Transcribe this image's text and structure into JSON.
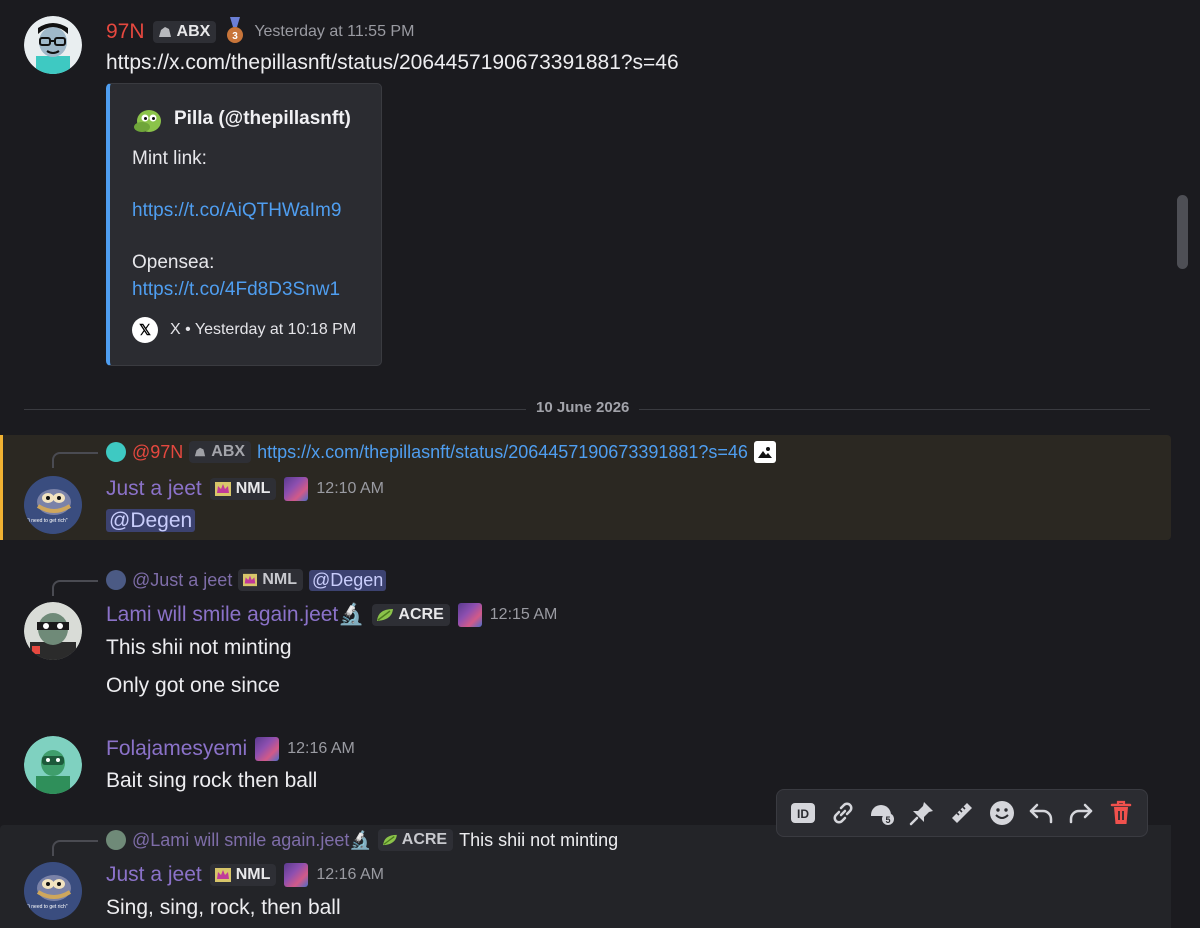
{
  "msg1": {
    "username": "97N",
    "tag": "ABX",
    "medal": "3",
    "timestamp": "Yesterday at 11:55 PM",
    "link": "https://x.com/thepillasnft/status/2064457190673391881?s=46",
    "embed": {
      "author": "Pilla (@thepillasnft)",
      "line1": "Mint link:",
      "link1": "https://t.co/AiQTHWaIm9",
      "line2": "Opensea:",
      "link2": "https://t.co/4Fd8D3Snw1",
      "footer": "X • Yesterday at 10:18 PM",
      "x_glyph": "𝕏"
    }
  },
  "divider": {
    "date": "10 June 2026"
  },
  "msg2": {
    "reply_user": "@97N",
    "reply_tag": "ABX",
    "reply_text": "https://x.com/thepillasnft/status/2064457190673391881?s=46",
    "username": "Just a jeet",
    "tag": "NML",
    "timestamp": "12:10 AM",
    "mention": "@Degen",
    "avatar_caption": "\"i need to get rich\""
  },
  "msg3": {
    "reply_user": "@Just a jeet",
    "reply_tag": "NML",
    "reply_mention": "@Degen",
    "username": "Lami will smile again.jeet🔬",
    "tag": "ACRE",
    "timestamp": "12:15 AM",
    "line1": "This shii not minting",
    "line2": "Only got one since"
  },
  "msg4": {
    "username": "Folajamesyemi",
    "timestamp": "12:16 AM",
    "line1": "Bait sing rock then ball"
  },
  "msg5": {
    "reply_user": "@Lami will smile again.jeet🔬",
    "reply_tag": "ACRE",
    "reply_text": "This shii not minting",
    "username": "Just a jeet",
    "tag": "NML",
    "timestamp": "12:16 AM",
    "line1": "Sing, sing, rock, then ball",
    "avatar_caption": "\"i need to get rich\""
  },
  "toolbar": [
    "ID",
    "link",
    "reply-to-thread",
    "pin",
    "mark",
    "emoji",
    "reply",
    "forward",
    "delete"
  ],
  "colors": {
    "background": "#1b1b1f",
    "link": "#4f9ef0",
    "username_red": "#e5483f",
    "username_purple": "#8b72c9",
    "highlight_bar": "#f0b232",
    "delete": "#f0514d"
  }
}
